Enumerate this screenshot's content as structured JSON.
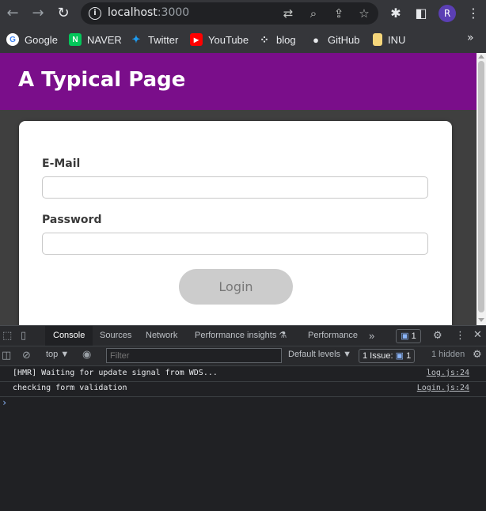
{
  "browser": {
    "url_host": "localhost",
    "url_port": ":3000",
    "profile_initial": "R",
    "bookmarks": [
      {
        "label": "Google",
        "icon": "G",
        "color": "#ffffff",
        "fg": "#4285f4"
      },
      {
        "label": "NAVER",
        "icon": "N",
        "color": "#03c75a",
        "fg": "#ffffff"
      },
      {
        "label": "Twitter",
        "icon": "🐦",
        "color": "#35363a",
        "fg": "#1d9bf0"
      },
      {
        "label": "YouTube",
        "icon": "▶",
        "color": "#ff0000",
        "fg": "#ffffff"
      },
      {
        "label": "blog",
        "icon": "⁘",
        "color": "#35363a",
        "fg": "#e8eaed"
      },
      {
        "label": "GitHub",
        "icon": "●",
        "color": "#35363a",
        "fg": "#e8eaed"
      },
      {
        "label": "INU",
        "icon": "▮",
        "color": "#f5d67b",
        "fg": "#f5d67b"
      }
    ],
    "more_bookmarks": "»"
  },
  "page": {
    "title": "A Typical Page",
    "email_label": "E-Mail",
    "email_value": "",
    "password_label": "Password",
    "password_value": "",
    "login_label": "Login"
  },
  "devtools": {
    "tabs": [
      "Console",
      "Sources",
      "Network",
      "Performance insights ⚗",
      "Performance"
    ],
    "more_tabs": "»",
    "message_count": "1",
    "context": "top ▼",
    "filter_placeholder": "Filter",
    "levels": "Default levels ▼",
    "issues_label": "1 Issue:",
    "issues_count": "1",
    "hidden": "1 hidden",
    "console_messages": [
      {
        "text": "[HMR] Waiting for update signal from WDS...",
        "source": "log.js:24"
      },
      {
        "text": "checking form validation",
        "source": "Login.js:24"
      }
    ],
    "prompt": "›"
  },
  "colors": {
    "header_purple": "#7a0e8a",
    "button_disabled": "#cccccc",
    "devtools_bg": "#202124"
  }
}
